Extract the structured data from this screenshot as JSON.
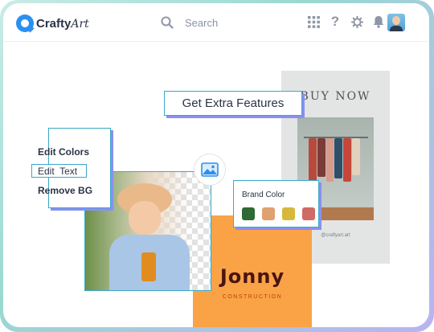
{
  "app": {
    "name_bold": "Crafty",
    "name_script": "Art"
  },
  "search": {
    "placeholder": "Search"
  },
  "header_icons": [
    "grid-icon",
    "help-icon",
    "settings-icon",
    "bell-icon"
  ],
  "menu": {
    "items": [
      "Edit Colors",
      "Edit  Text",
      "Remove BG"
    ],
    "selected_index": 1
  },
  "extra_features": {
    "label": "Get Extra Features"
  },
  "brand_color": {
    "title": "Brand Color",
    "colors": [
      "#2d6a35",
      "#e0a070",
      "#d8b83a",
      "#cf6a66"
    ]
  },
  "poster": {
    "headline": "BUY NOW",
    "handle": "@craftyart.art"
  },
  "logo_card": {
    "name": "Jonny",
    "tagline": "CONSTRUCTION"
  },
  "colors": {
    "accent": "#3aa8c8",
    "shadow": "#8a8ff0",
    "orange": "#f9a346",
    "brand_blue": "#2b8ff0"
  }
}
